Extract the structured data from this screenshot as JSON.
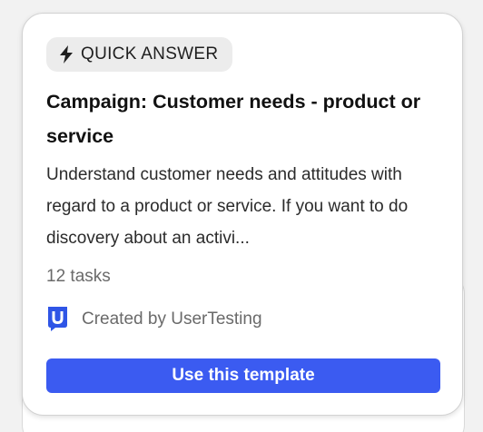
{
  "card": {
    "badge": {
      "icon": "lightning-bolt-icon",
      "label": "QUICK ANSWER"
    },
    "title": "Campaign: Customer needs - product or service",
    "description": "Understand customer needs and attitudes with regard to a product or service. If you want to do discovery about an activi...",
    "task_count": "12 tasks",
    "creator": {
      "icon": "usertesting-logo-icon",
      "label": "Created by UserTesting"
    },
    "cta_label": "Use this template"
  },
  "colors": {
    "accent": "#3b5bf1",
    "badge_bg": "#ececec",
    "logo_blue": "#2f55e6"
  }
}
